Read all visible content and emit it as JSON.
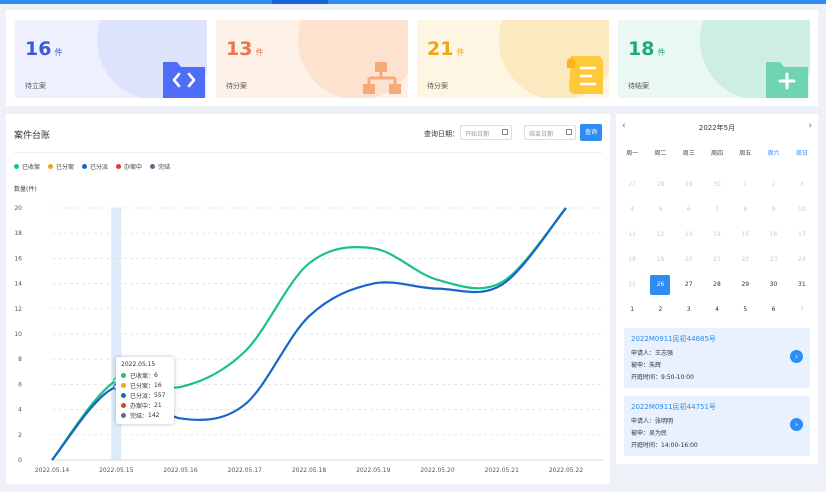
{
  "stats": [
    {
      "value": "16",
      "unit": "件",
      "label": "待立案",
      "color": "#3b5bdb",
      "bg": "#eef1fd",
      "circle": "#dde3fb",
      "icon": "code-folder-icon"
    },
    {
      "value": "13",
      "unit": "件",
      "label": "待分案",
      "color": "#e8774a",
      "bg": "#fdf1e8",
      "circle": "#fce2cf",
      "icon": "org-chart-icon"
    },
    {
      "value": "21",
      "unit": "件",
      "label": "待分案",
      "color": "#f0a61b",
      "bg": "#fdf6e3",
      "circle": "#fbeac0",
      "icon": "document-icon"
    },
    {
      "value": "18",
      "unit": "件",
      "label": "待结案",
      "color": "#22a87a",
      "bg": "#eaf8f3",
      "circle": "#cdeee1",
      "icon": "add-folder-icon"
    }
  ],
  "ledger": {
    "title": "案件台账",
    "query_label": "查询日期：",
    "start_placeholder": "开始日期",
    "end_placeholder": "结束日期",
    "query_button": "查询"
  },
  "legend": [
    {
      "name": "已收案",
      "color": "#19c37d"
    },
    {
      "name": "已分案",
      "color": "#f0a61b"
    },
    {
      "name": "已分派",
      "color": "#1766c9"
    },
    {
      "name": "办案中",
      "color": "#e53935"
    },
    {
      "name": "完结",
      "color": "#5c6b8a"
    }
  ],
  "chart_data": {
    "type": "line",
    "ylabel": "数量(件)",
    "ylim": [
      0,
      20
    ],
    "yticks": [
      0,
      2,
      4,
      6,
      8,
      10,
      12,
      14,
      16,
      18,
      20
    ],
    "x": [
      "2022.05.14",
      "2022.05.15",
      "2022.05.16",
      "2022.05.17",
      "2022.05.18",
      "2022.05.19",
      "2022.05.20",
      "2022.05.21",
      "2022.05.22"
    ],
    "series": [
      {
        "name": "已收案",
        "color": "#19c37d",
        "values": [
          0,
          6.3,
          5.8,
          8.6,
          15.6,
          16.8,
          14.3,
          14.1,
          20
        ]
      },
      {
        "name": "已分派",
        "color": "#1766c9",
        "values": [
          0,
          5.8,
          3.3,
          4.4,
          11.4,
          14,
          13.6,
          13.9,
          20
        ]
      }
    ],
    "highlight_index": 1
  },
  "tooltip": {
    "date": "2022.05.15",
    "rows": [
      {
        "name": "已收案",
        "value": "6",
        "color": "#19c37d"
      },
      {
        "name": "已分案",
        "value": "16",
        "color": "#f0a61b"
      },
      {
        "name": "已分派",
        "value": "557",
        "color": "#1766c9"
      },
      {
        "name": "办案中",
        "value": "21",
        "color": "#e53935"
      },
      {
        "name": "完结",
        "value": "142",
        "color": "#5c6b8a"
      }
    ]
  },
  "calendar": {
    "title": "2022年5月",
    "prev": "‹",
    "next": "›",
    "weekdays": [
      {
        "label": "周一",
        "weekend": false
      },
      {
        "label": "周二",
        "weekend": false
      },
      {
        "label": "周三",
        "weekend": false
      },
      {
        "label": "周四",
        "weekend": false
      },
      {
        "label": "周五",
        "weekend": false
      },
      {
        "label": "周六",
        "weekend": true
      },
      {
        "label": "周日",
        "weekend": true
      }
    ],
    "days": [
      {
        "d": "27",
        "s": "muted"
      },
      {
        "d": "28",
        "s": "muted"
      },
      {
        "d": "29",
        "s": "muted"
      },
      {
        "d": "30",
        "s": "muted"
      },
      {
        "d": "1",
        "s": "muted"
      },
      {
        "d": "2",
        "s": "muted"
      },
      {
        "d": "3",
        "s": "muted"
      },
      {
        "d": "4",
        "s": "muted"
      },
      {
        "d": "5",
        "s": "muted"
      },
      {
        "d": "6",
        "s": "muted"
      },
      {
        "d": "7",
        "s": "muted"
      },
      {
        "d": "8",
        "s": "muted"
      },
      {
        "d": "9",
        "s": "muted"
      },
      {
        "d": "10",
        "s": "muted"
      },
      {
        "d": "11",
        "s": "muted"
      },
      {
        "d": "12",
        "s": "muted"
      },
      {
        "d": "13",
        "s": "muted"
      },
      {
        "d": "14",
        "s": "muted"
      },
      {
        "d": "15",
        "s": "muted"
      },
      {
        "d": "16",
        "s": "muted"
      },
      {
        "d": "17",
        "s": "muted"
      },
      {
        "d": "18",
        "s": "muted"
      },
      {
        "d": "19",
        "s": "muted"
      },
      {
        "d": "20",
        "s": "muted"
      },
      {
        "d": "21",
        "s": "muted"
      },
      {
        "d": "22",
        "s": "muted"
      },
      {
        "d": "23",
        "s": "muted"
      },
      {
        "d": "24",
        "s": "muted"
      },
      {
        "d": "25",
        "s": "muted"
      },
      {
        "d": "26",
        "s": "selected"
      },
      {
        "d": "27",
        "s": "near"
      },
      {
        "d": "28",
        "s": "near"
      },
      {
        "d": "29",
        "s": "near"
      },
      {
        "d": "30",
        "s": "near"
      },
      {
        "d": "31",
        "s": "near"
      },
      {
        "d": "1",
        "s": "near"
      },
      {
        "d": "2",
        "s": "near"
      },
      {
        "d": "3",
        "s": "near"
      },
      {
        "d": "4",
        "s": "near"
      },
      {
        "d": "5",
        "s": "near"
      },
      {
        "d": "6",
        "s": "near"
      },
      {
        "d": "7",
        "s": "muted"
      }
    ]
  },
  "cases": [
    {
      "title": "2022M0911民初44685号",
      "applicant": "申请人：王志强",
      "respondent": "被申：朱辉",
      "time": "开庭时间：9:50-10:00",
      "go": "›"
    },
    {
      "title": "2022M0911民初44751号",
      "applicant": "申请人：张明明",
      "respondent": "被申：吴为民",
      "time": "开庭时间：14:00-16:00",
      "go": "›"
    }
  ]
}
